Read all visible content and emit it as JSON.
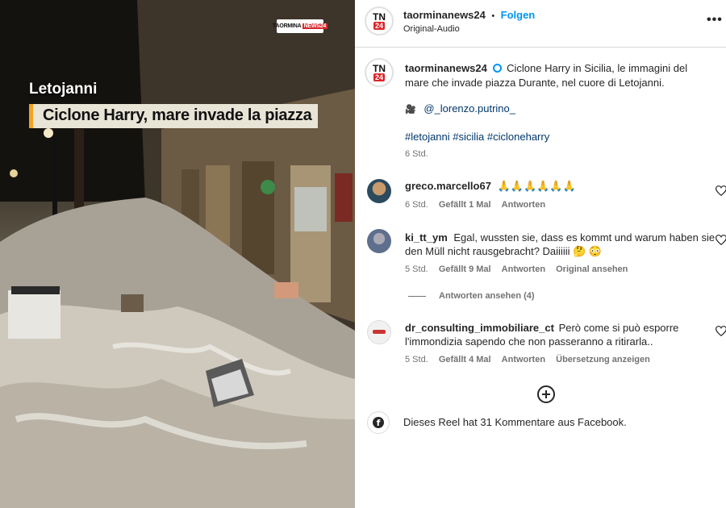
{
  "video": {
    "place": "Letojanni",
    "headline": "Ciclone Harry, mare invade la piazza",
    "watermark_text": "TAORMINA",
    "watermark_badge": "NEWS24"
  },
  "header": {
    "account": "taorminanews24",
    "separator": "•",
    "follow_label": "Folgen",
    "audio_label": "Original-Audio",
    "more_icon": "more-dots-icon",
    "logo_top": "TN",
    "logo_badge": "24"
  },
  "caption": {
    "account": "taorminanews24",
    "text": "Ciclone Harry in Sicilia, le immagini del mare che invade piazza Durante, nel cuore di Letojanni.",
    "mention": "@_lorenzo.putrino_",
    "hashtags": "#letojanni #sicilia #cicloneharry",
    "time": "6 Std."
  },
  "comments": [
    {
      "user": "greco.marcello67",
      "text": "🙏🙏🙏🙏🙏🙏",
      "time": "6 Std.",
      "likes": "Gefällt 1 Mal",
      "reply": "Antworten"
    },
    {
      "user": "ki_tt_ym",
      "text": "Egal, wussten sie, dass es kommt und warum haben sie den Müll nicht rausgebracht? Daiiiiii 🤔 😳",
      "time": "5 Std.",
      "likes": "Gefällt 9 Mal",
      "reply": "Antworten",
      "extra": "Original ansehen",
      "view_replies": "Antworten ansehen (4)"
    },
    {
      "user": "dr_consulting_immobiliare_ct",
      "text": "Però come si può esporre l'immondizia sapendo che non passeranno a ritirarla..",
      "time": "5 Std.",
      "likes": "Gefällt 4 Mal",
      "reply": "Antworten",
      "extra": "Übersetzung anzeigen"
    }
  ],
  "footer": {
    "load_more_icon": "plus-circle-icon",
    "facebook_icon": "facebook-icon",
    "facebook_text": "Dieses Reel hat 31 Kommentare aus Facebook."
  },
  "colors": {
    "link_blue": "#0095f6",
    "muted_text": "#737373",
    "brand_red": "#d9262b",
    "headline_accent": "#f2a320"
  }
}
